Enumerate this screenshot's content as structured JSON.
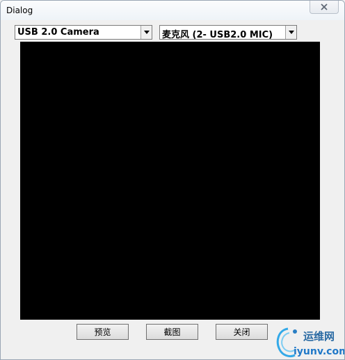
{
  "window": {
    "title": "Dialog"
  },
  "controls": {
    "video_device": {
      "selected": "USB 2.0 Camera"
    },
    "audio_device": {
      "selected": "麦克风 (2- USB2.0 MIC)"
    }
  },
  "buttons": {
    "preview_label": "预览",
    "capture_label": "截图",
    "close_label": "关闭"
  },
  "watermark": {
    "site_name": "运维网",
    "url": "iyunv.com"
  },
  "colors": {
    "preview_background": "#000000",
    "window_background": "#f0f0f0",
    "watermark_blue": "#1f78c8"
  },
  "icons": {
    "close": "close-icon",
    "dropdown": "chevron-down-icon",
    "logo": "swirl-logo-icon"
  }
}
